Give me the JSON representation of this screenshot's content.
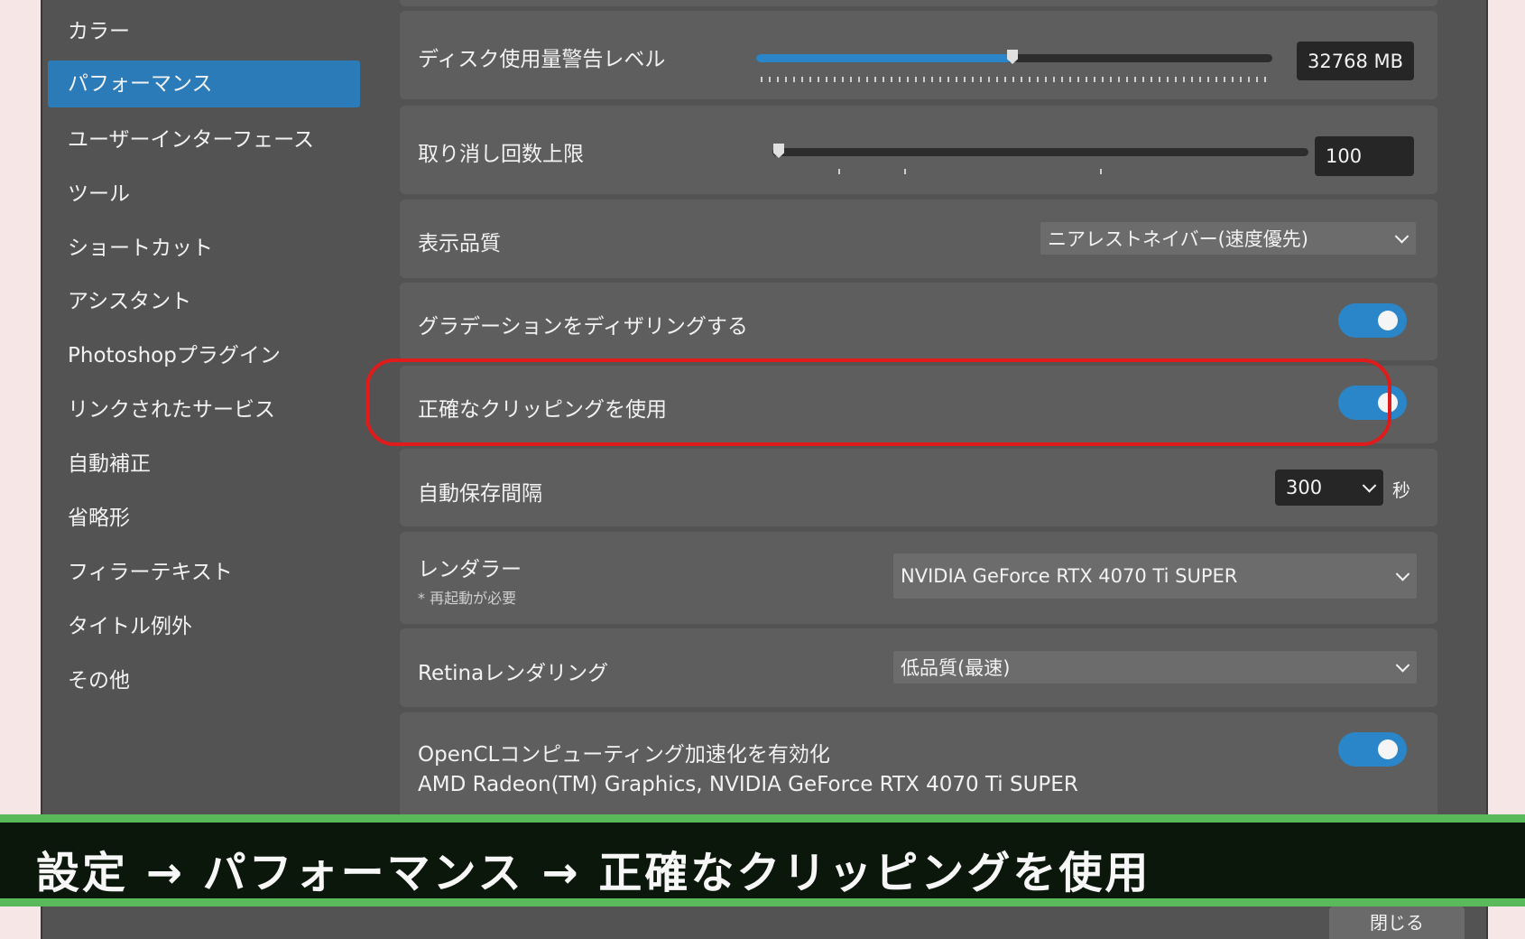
{
  "sidebar": {
    "items": [
      {
        "label": "カラー"
      },
      {
        "label": "パフォーマンス"
      },
      {
        "label": "ユーザーインターフェース"
      },
      {
        "label": "ツール"
      },
      {
        "label": "ショートカット"
      },
      {
        "label": "アシスタント"
      },
      {
        "label": "Photoshopプラグイン"
      },
      {
        "label": "リンクされたサービス"
      },
      {
        "label": "自動補正"
      },
      {
        "label": "省略形"
      },
      {
        "label": "フィラーテキスト"
      },
      {
        "label": "タイトル例外"
      },
      {
        "label": "その他"
      }
    ],
    "active_index": 1
  },
  "settings": {
    "disk_warning": {
      "label": "ディスク使用量警告レベル",
      "value": "32768 MB",
      "slider_fraction": 0.5
    },
    "undo_limit": {
      "label": "取り消し回数上限",
      "value": "100",
      "slider_fraction": 0.01
    },
    "display_quality": {
      "label": "表示品質",
      "selected": "ニアレストネイバー(速度優先)"
    },
    "dither_gradients": {
      "label": "グラデーションをディザリングする",
      "on": true
    },
    "precise_clipping": {
      "label": "正確なクリッピングを使用",
      "on": true
    },
    "autosave_interval": {
      "label": "自動保存間隔",
      "selected": "300",
      "unit": "秒"
    },
    "renderer": {
      "label": "レンダラー",
      "note": "* 再起動が必要",
      "selected": "NVIDIA GeForce RTX 4070 Ti SUPER"
    },
    "retina_rendering": {
      "label": "Retinaレンダリング",
      "selected": "低品質(最速)"
    },
    "opencl": {
      "label": "OpenCLコンピューティング加速化を有効化",
      "devices": "AMD Radeon(TM) Graphics, NVIDIA GeForce RTX 4070 Ti SUPER",
      "on": true
    }
  },
  "caption": {
    "text": "設定 → パフォーマンス → 正確なクリッピングを使用"
  },
  "footer": {
    "close_label": "閉じる"
  },
  "colors": {
    "accent": "#2b86c9",
    "highlight": "#e01b1b",
    "caption_border": "#5ab95a"
  }
}
